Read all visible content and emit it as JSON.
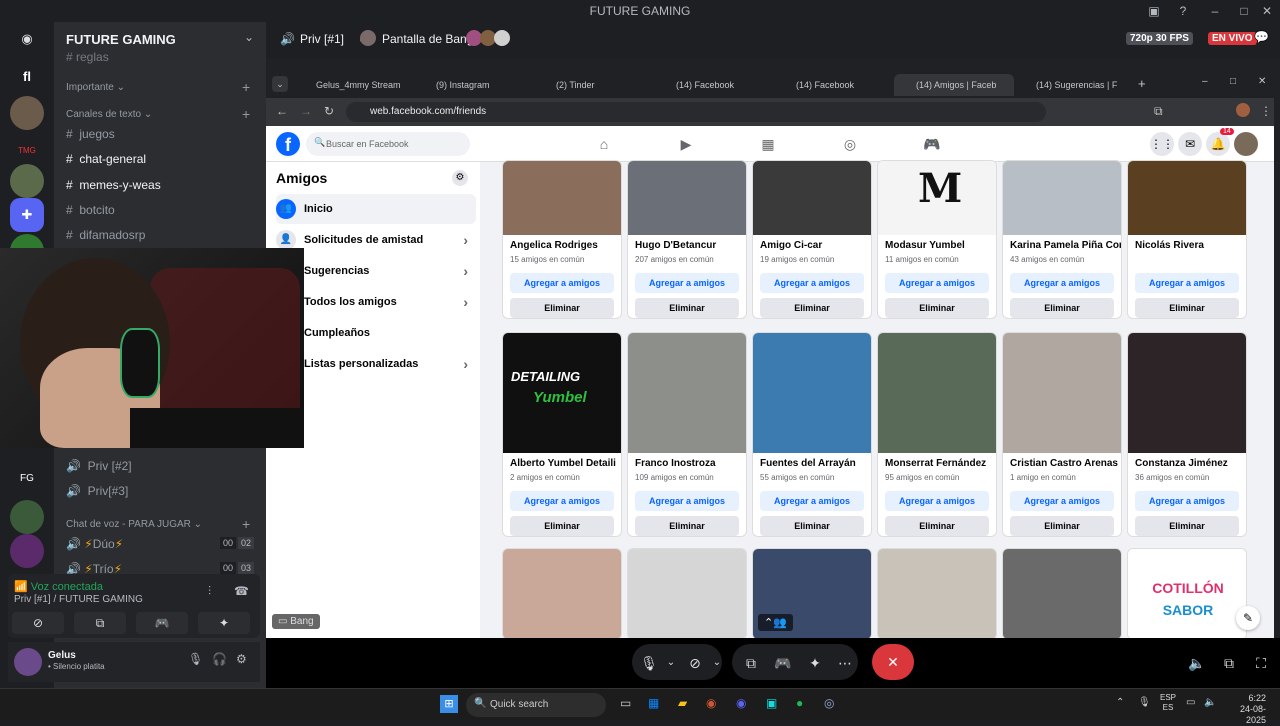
{
  "app": {
    "title": "FUTURE GAMING"
  },
  "discord": {
    "server_name": "FUTURE GAMING",
    "channels_top": {
      "regl": "reglas"
    },
    "categories": {
      "importante": "Importante",
      "texto": "Canales de texto",
      "voz": "Chat de voz - PARA JUGAR"
    },
    "text_channels": [
      "juegos",
      "chat-general",
      "memes-y-weas",
      "botcito",
      "difamadosrp"
    ],
    "priv_channels": [
      "Priv [#2]",
      "Priv[#3]"
    ],
    "voice_channels": [
      {
        "name": "Dúo",
        "counts": [
          "00",
          "02"
        ]
      },
      {
        "name": "Trío",
        "counts": [
          "00",
          "03"
        ]
      }
    ],
    "rail_labels": {
      "tmg": "TMG",
      "fg": "FG"
    },
    "voice": {
      "status": "Voz conectada",
      "channel": "Priv [#1] / FUTURE GAMING"
    },
    "user": {
      "name": "Gelus",
      "status": "• Silencio platita"
    }
  },
  "stream": {
    "channel": "Priv [#1]",
    "screen_label": "Pantalla de Bang",
    "quality": "720p 30 FPS",
    "live": "EN VIVO",
    "streamer_tag": "Bang"
  },
  "browser": {
    "url": "web.facebook.com/friends",
    "tabs": [
      "Gelus_4mmy Stream",
      "(9) Instagram",
      "(2) Tinder",
      "(14) Facebook",
      "(14) Facebook",
      "(14) Amigos | Faceb",
      "(14) Sugerencias | F"
    ]
  },
  "facebook": {
    "search_placeholder": "Buscar en Facebook",
    "notifications": "14",
    "sidebar_title": "Amigos",
    "sidebar": [
      {
        "label": "Inicio",
        "arrow": false
      },
      {
        "label": "Solicitudes de amistad",
        "arrow": true
      },
      {
        "label": "Sugerencias",
        "arrow": true
      },
      {
        "label": "Todos los amigos",
        "arrow": true
      },
      {
        "label": "Cumpleaños",
        "arrow": false
      },
      {
        "label": "Listas personalizadas",
        "arrow": true
      }
    ],
    "add_label": "Agregar a amigos",
    "remove_label": "Eliminar",
    "row1": [
      {
        "name": "Angelica Rodriges",
        "mutual": "15 amigos en común",
        "color": "#8a6d5a"
      },
      {
        "name": "Hugo D'Betancur",
        "mutual": "207 amigos en común",
        "color": "#6b6f78"
      },
      {
        "name": "Amigo Ci-car",
        "mutual": "19 amigos en común",
        "color": "#3a3a3a"
      },
      {
        "name": "Modasur Yumbel",
        "mutual": "11 amigos en común",
        "color": "#f4f4f4"
      },
      {
        "name": "Karina Pamela Piña Cor",
        "mutual": "43 amigos en común",
        "color": "#b7bec6"
      },
      {
        "name": "Nicolás Rivera",
        "mutual": "",
        "color": "#5a4020"
      }
    ],
    "row2": [
      {
        "name": "Alberto Yumbel Detaili",
        "mutual": "2 amigos en común",
        "color": "#101010"
      },
      {
        "name": "Franco Inostroza",
        "mutual": "109 amigos en común",
        "color": "#8c8f8a"
      },
      {
        "name": "Fuentes del Arrayán",
        "mutual": "55 amigos en común",
        "color": "#3b7bb0"
      },
      {
        "name": "Monserrat Fernández",
        "mutual": "95 amigos en común",
        "color": "#5a6a58"
      },
      {
        "name": "Cristian Castro Arenas",
        "mutual": "1 amigo en común",
        "color": "#b0a8a0"
      },
      {
        "name": "Constanza Jiménez",
        "mutual": "36 amigos en común",
        "color": "#2c2426"
      }
    ],
    "row3_colors": [
      "#c9a89a",
      "#d6d6d6",
      "#3a4a6a",
      "#c8c2b8",
      "#6a6a6a",
      "#ffffff"
    ],
    "cotillon": "COTILLÓN",
    "sabor": "SABOR",
    "detailing": "DETAILING",
    "yumbel": "Yumbel"
  },
  "taskbar": {
    "search": "Quick search",
    "lang": "ESP",
    "lang2": "ES",
    "time": "6:22",
    "date": "24-08-2025"
  }
}
